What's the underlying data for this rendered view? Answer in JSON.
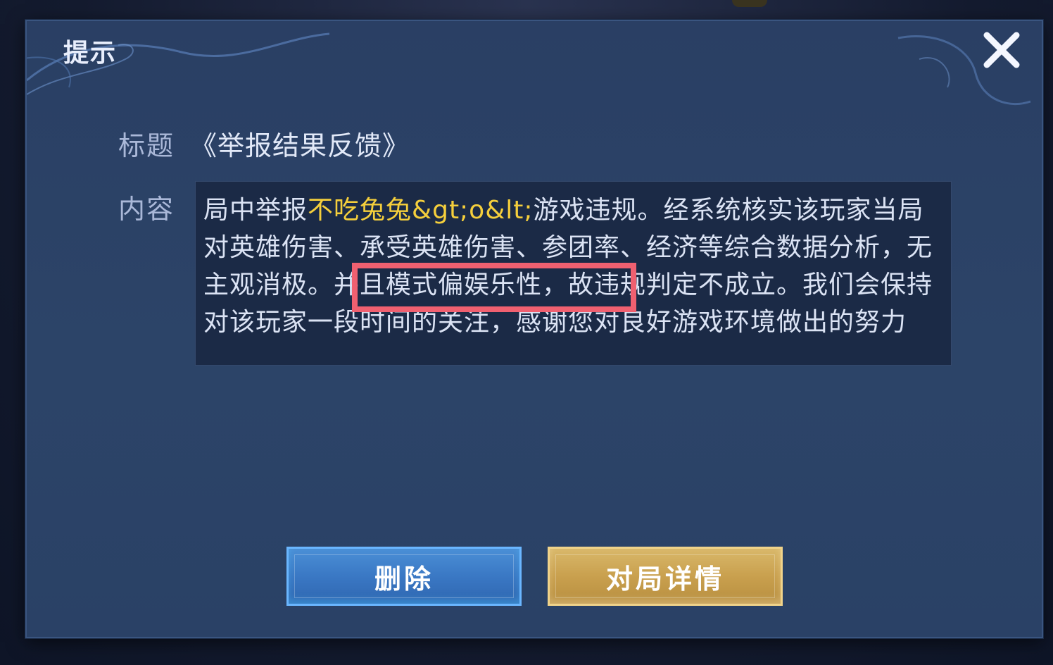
{
  "dialog": {
    "title": "提示",
    "close_icon": "close-icon"
  },
  "fields": {
    "title_label": "标题",
    "title_value": "《举报结果反馈》",
    "content_label": "内容"
  },
  "content": {
    "prefix": "局中举报",
    "player_name": "不吃兔兔&gt;o&lt;",
    "body": "游戏违规。经系统核实该玩家当局对英雄伤害、承受英雄伤害、参团率、经济等综合数据分析，无主观消极。并且模式偏娱乐性，故违规判定不成立。我们会保持对该玩家一段时间的关注，感谢您对良好游戏环境做出的努力"
  },
  "buttons": {
    "delete_label": "删除",
    "detail_label": "对局详情"
  },
  "colors": {
    "dialog_bg": "#2a4166",
    "name_highlight": "#f5cf3c",
    "annotation_box": "#f06070",
    "delete_button": "#3a78c4",
    "detail_button": "#c9a04e"
  }
}
